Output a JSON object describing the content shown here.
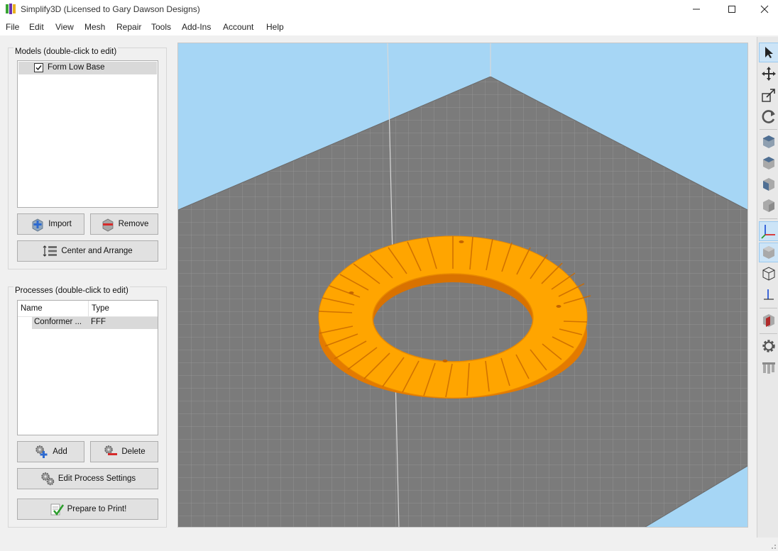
{
  "window": {
    "title": "Simplify3D (Licensed to Gary Dawson Designs)",
    "controls": [
      "minimize",
      "maximize",
      "close"
    ]
  },
  "menubar": {
    "items": [
      "File",
      "Edit",
      "View",
      "Mesh",
      "Repair",
      "Tools",
      "Add-Ins",
      "Account",
      "Help"
    ]
  },
  "models_panel": {
    "title": "Models (double-click to edit)",
    "items": [
      {
        "label": "Form Low Base",
        "checked": true,
        "selected": true
      }
    ],
    "import_label": "Import",
    "remove_label": "Remove",
    "center_label": "Center and Arrange"
  },
  "processes_panel": {
    "title": "Processes (double-click to edit)",
    "columns": [
      "Name",
      "Type"
    ],
    "rows": [
      {
        "name": "Conformer ...",
        "type": "FFF",
        "selected": true
      }
    ],
    "add_label": "Add",
    "delete_label": "Delete",
    "edit_label": "Edit Process Settings",
    "prepare_label": "Prepare to Print!"
  },
  "toolbar": {
    "tools": [
      "select-arrow-icon",
      "move-icon",
      "scale-icon",
      "rotate-icon",
      "view-default-cube-icon",
      "view-top-cube-icon",
      "view-front-cube-icon",
      "view-side-cube-icon",
      "axes-icon",
      "solid-cube-icon",
      "wireframe-cube-icon",
      "build-axis-icon",
      "cross-section-icon",
      "settings-gear-icon",
      "support-structures-icon"
    ]
  },
  "colors": {
    "sky": "#a8d8f5",
    "bed": "#7f7f7f",
    "model": "#ffa500",
    "model_dark": "#e07800"
  }
}
